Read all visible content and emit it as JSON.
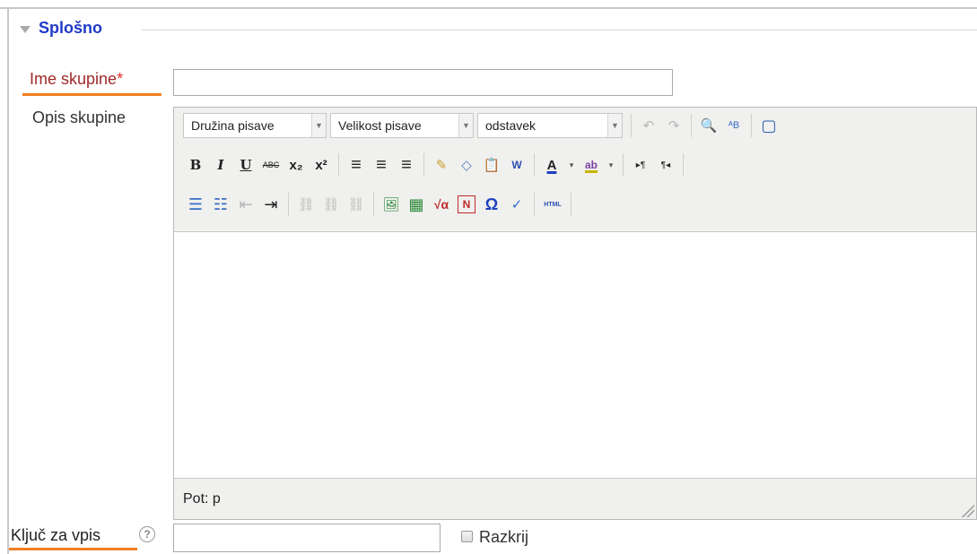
{
  "fieldset": {
    "legend": "Splošno"
  },
  "group_name": {
    "label": "Ime skupine",
    "required_mark": "*",
    "value": ""
  },
  "group_desc": {
    "label": "Opis skupine",
    "font_family_select": "Družina pisave",
    "font_size_select": "Velikost pisave",
    "format_select": "odstavek",
    "status_path": "Pot: p",
    "toolbar_row1": {
      "undo": "↶",
      "redo": "↷",
      "find": "🔍",
      "replace": "ᴬB",
      "fullscreen": "▢"
    },
    "toolbar_row2": {
      "bold": "B",
      "italic": "I",
      "underline": "U",
      "strike": "ABC",
      "subscript": "x₂",
      "superscript": "x²",
      "align_left": "≡",
      "align_center": "≡",
      "align_right": "≡",
      "cleanup": "✎",
      "remove_format": "◇",
      "paste_text": "📋",
      "paste_word": "W",
      "text_color": "A",
      "highlight": "ab",
      "dropdown_arrow": "▾",
      "ltr": "▸¶",
      "rtl": "¶◂"
    },
    "toolbar_row3": {
      "bullet_list": "☰",
      "number_list": "☷",
      "outdent": "⇤",
      "indent": "⇥",
      "link": "⛓",
      "unlink": "⛓",
      "anchor": "⛓",
      "image": "🖼",
      "media": "▦",
      "equation": "√α",
      "nolink": "N",
      "special_char": "Ω",
      "spellcheck": "✓",
      "html": "HTML"
    }
  },
  "enroll_key": {
    "label": "Ključ za vpis",
    "help": "?",
    "value": ""
  },
  "reveal": {
    "label": "Razkrij"
  }
}
